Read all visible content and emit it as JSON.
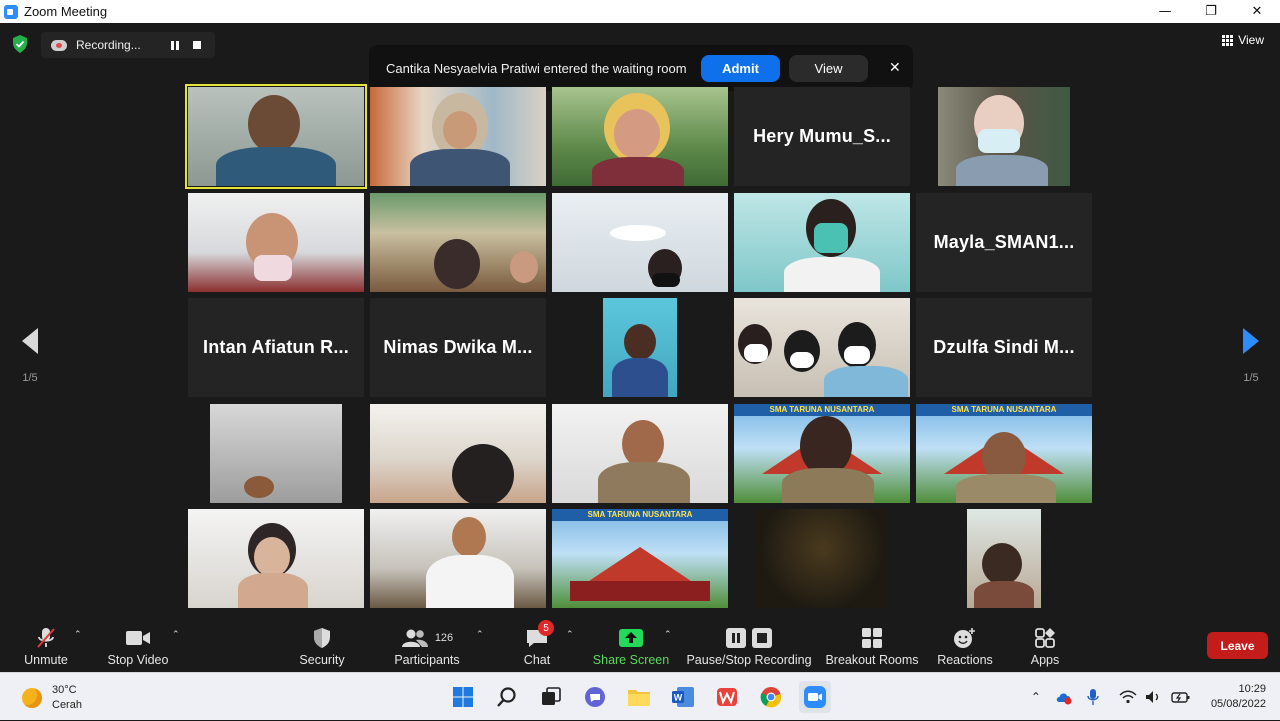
{
  "window": {
    "title": "Zoom Meeting",
    "minimize": "—",
    "maximize": "❐",
    "close": "✕"
  },
  "recording": {
    "label": "Recording..."
  },
  "notification": {
    "message": "Cantika Nesyaelvia Pratiwi entered the waiting room",
    "admit": "Admit",
    "view": "View",
    "close": "✕"
  },
  "view_button": {
    "label": "View"
  },
  "pager": {
    "left": "1/5",
    "right": "1/5"
  },
  "gallery": {
    "names": {
      "hery": "Hery  Mumu_S...",
      "mayla": "Mayla_SMAN1...",
      "intan": "Intan  Afiatun  R...",
      "nimas": "Nimas  Dwika  M...",
      "dzulfa": "Dzulfa  Sindi  M..."
    },
    "banner": "SMA TARUNA NUSANTARA"
  },
  "toolbar": {
    "unmute": "Unmute",
    "stop_video": "Stop Video",
    "security": "Security",
    "participants": "Participants",
    "participants_count": "126",
    "chat": "Chat",
    "chat_badge": "5",
    "share_screen": "Share Screen",
    "pause_stop_recording": "Pause/Stop Recording",
    "breakout_rooms": "Breakout Rooms",
    "reactions": "Reactions",
    "apps": "Apps",
    "leave": "Leave"
  },
  "taskbar": {
    "weather_temp": "30°C",
    "weather_desc": "Cerah",
    "time": "10:29",
    "date": "05/08/2022"
  },
  "colors": {
    "zoom_blue": "#0e71eb",
    "leave_red": "#c41b1b",
    "share_green": "#23d959",
    "active_speaker": "#e3e33a"
  }
}
